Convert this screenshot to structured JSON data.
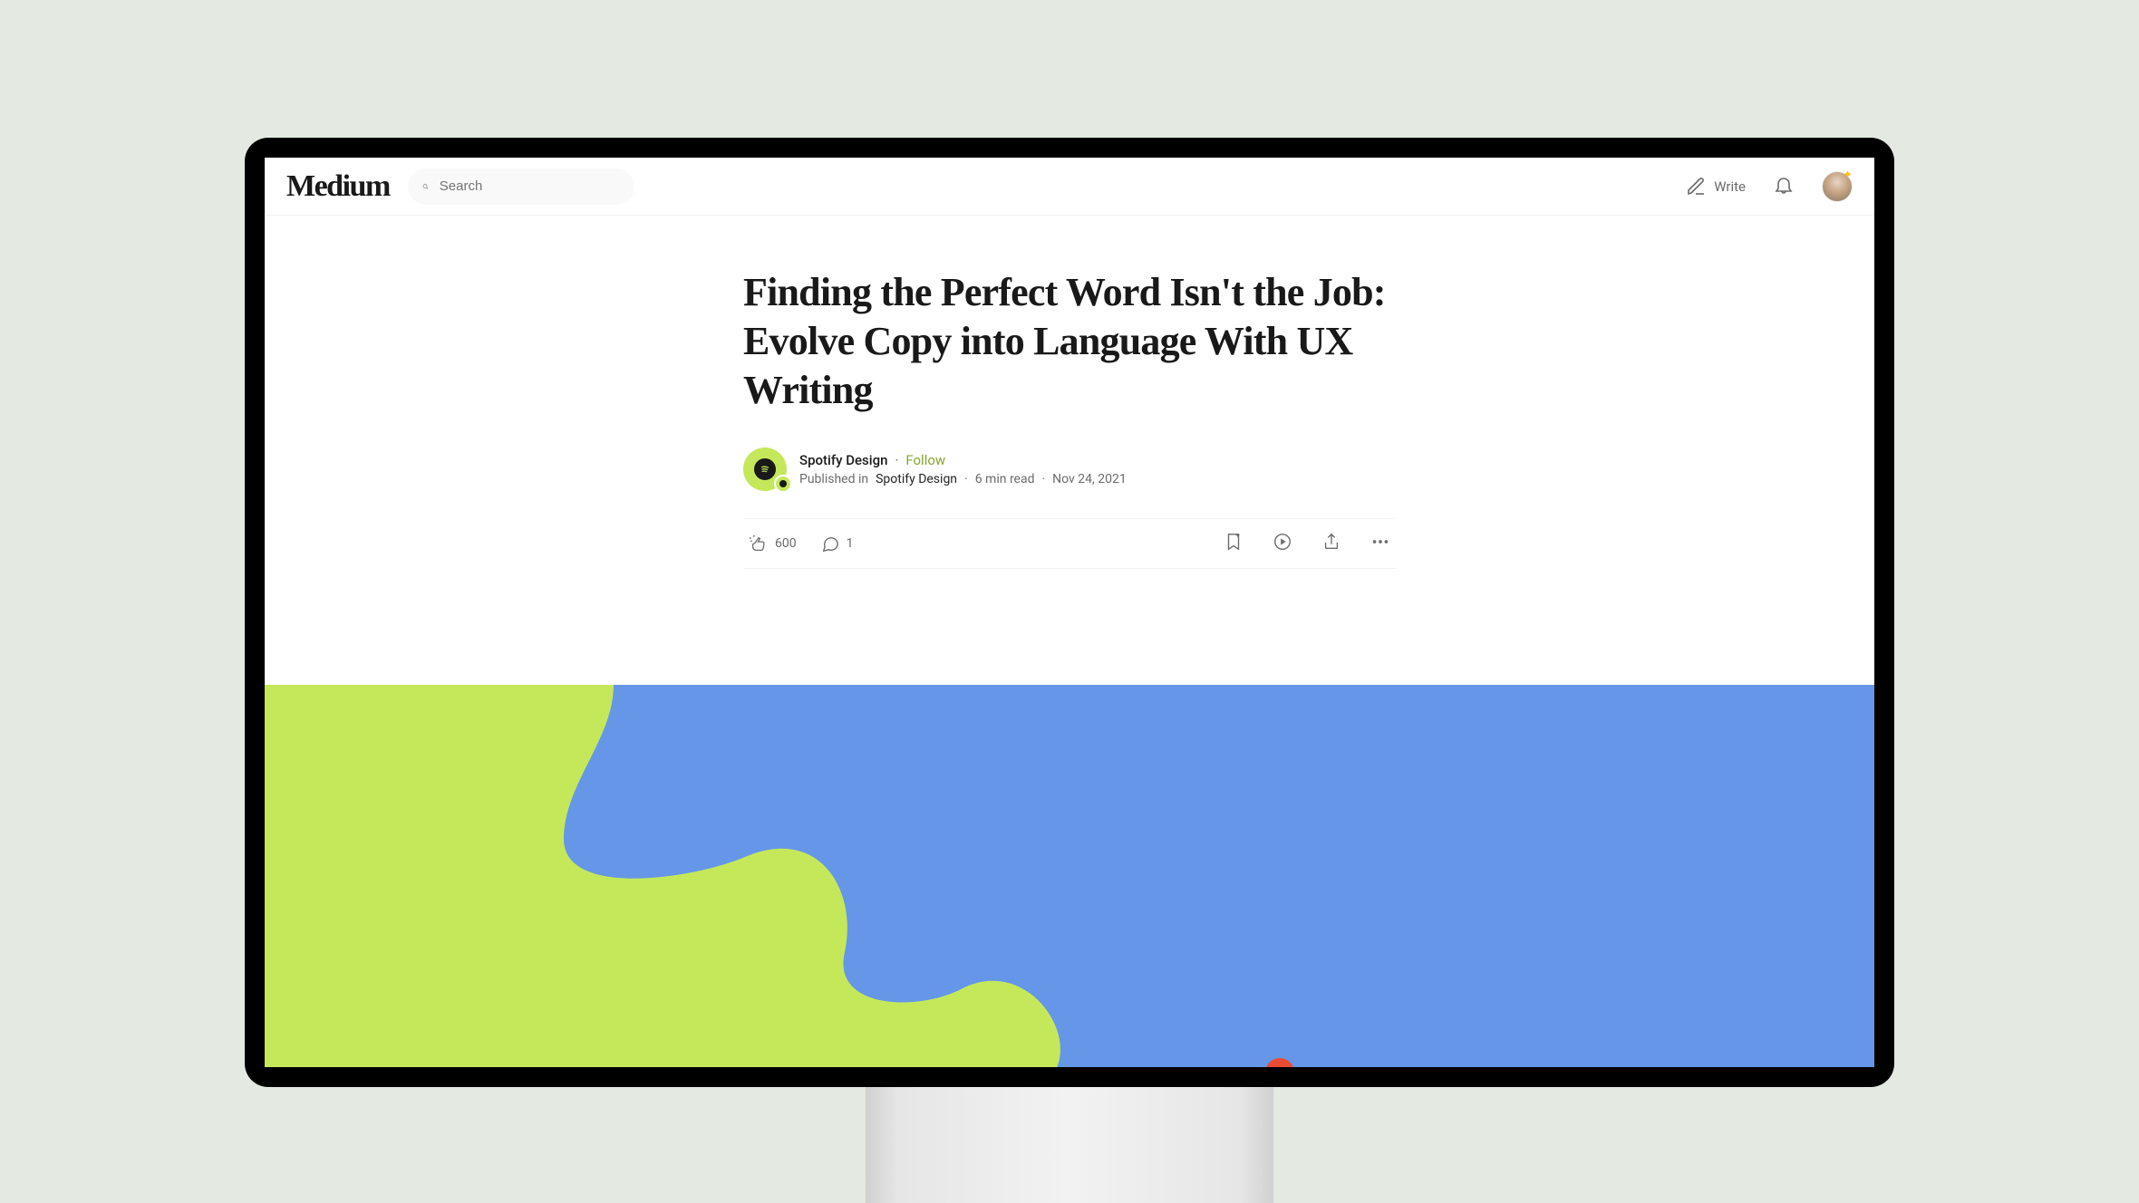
{
  "header": {
    "logo": "Medium",
    "search_placeholder": "Search",
    "write_label": "Write"
  },
  "article": {
    "title": "Finding the Perfect Word Isn't the Job: Evolve Copy into Language With UX Writing",
    "author": "Spotify Design",
    "follow_label": "Follow",
    "published_prefix": "Published in",
    "publication": "Spotify Design",
    "read_time": "6 min read",
    "date": "Nov 24, 2021"
  },
  "engagement": {
    "claps": "600",
    "comments": "1"
  },
  "colors": {
    "hero_green": "#c5e85b",
    "hero_blue": "#6596e8",
    "accent_follow": "#82a82f"
  }
}
